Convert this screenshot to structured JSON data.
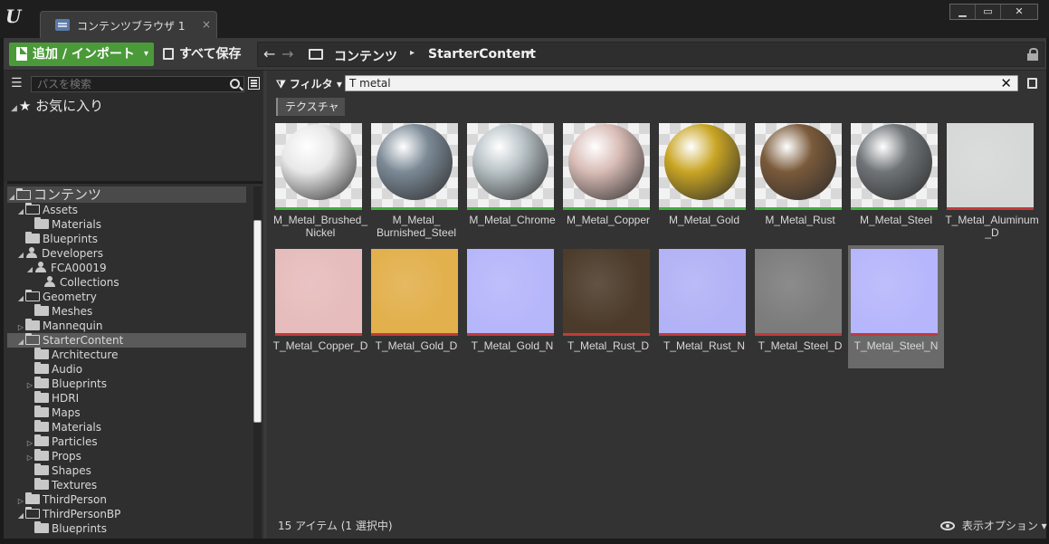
{
  "window": {
    "tab_label": "コンテンツブラウザ 1",
    "tab_close": "×",
    "minimize": "▁",
    "maximize": "▭",
    "close": "✕"
  },
  "toolbar": {
    "add_import_label": "追加 / インポート",
    "add_import_caret": "▾",
    "save_all_label": "すべて保存",
    "back_arrow": "←",
    "forward_arrow": "→",
    "breadcrumbs": [
      "コンテンツ",
      "StarterContent"
    ],
    "crumb_separator": "▸"
  },
  "left_panel": {
    "path_search_placeholder": "パスを検索",
    "favorites_label": "お気に入り",
    "tree": [
      {
        "label": "コンテンツ",
        "arrow": "◢",
        "icon": "folder-open"
      },
      {
        "label": "Assets",
        "arrow": "◢",
        "icon": "folder-open"
      },
      {
        "label": "Materials",
        "arrow": "",
        "icon": "folder"
      },
      {
        "label": "Blueprints",
        "arrow": "",
        "icon": "folder"
      },
      {
        "label": "Developers",
        "arrow": "◢",
        "icon": "person"
      },
      {
        "label": "FCA00019",
        "arrow": "◢",
        "icon": "person"
      },
      {
        "label": "Collections",
        "arrow": "",
        "icon": "person"
      },
      {
        "label": "Geometry",
        "arrow": "◢",
        "icon": "folder-open"
      },
      {
        "label": "Meshes",
        "arrow": "",
        "icon": "folder"
      },
      {
        "label": "Mannequin",
        "arrow": "▷",
        "icon": "folder"
      },
      {
        "label": "StarterContent",
        "arrow": "◢",
        "icon": "folder-open",
        "selected": true
      },
      {
        "label": "Architecture",
        "arrow": "",
        "icon": "folder"
      },
      {
        "label": "Audio",
        "arrow": "",
        "icon": "folder"
      },
      {
        "label": "Blueprints",
        "arrow": "▷",
        "icon": "folder"
      },
      {
        "label": "HDRI",
        "arrow": "",
        "icon": "folder"
      },
      {
        "label": "Maps",
        "arrow": "",
        "icon": "folder"
      },
      {
        "label": "Materials",
        "arrow": "",
        "icon": "folder"
      },
      {
        "label": "Particles",
        "arrow": "▷",
        "icon": "folder"
      },
      {
        "label": "Props",
        "arrow": "▷",
        "icon": "folder"
      },
      {
        "label": "Shapes",
        "arrow": "",
        "icon": "folder"
      },
      {
        "label": "Textures",
        "arrow": "",
        "icon": "folder"
      },
      {
        "label": "ThirdPerson",
        "arrow": "▷",
        "icon": "folder"
      },
      {
        "label": "ThirdPersonBP",
        "arrow": "◢",
        "icon": "folder-open"
      },
      {
        "label": "Blueprints",
        "arrow": "",
        "icon": "folder"
      }
    ]
  },
  "content": {
    "filter_label": "フィルタ",
    "search_value": "T metal",
    "filter_chip": "テクスチャ",
    "assets": [
      {
        "name": "M_Metal_Brushed_\nNickel",
        "kind": "material",
        "color": "#e8e8e8"
      },
      {
        "name": "M_Metal_\nBurnished_Steel",
        "kind": "material",
        "color": "#7c8a96"
      },
      {
        "name": "M_Metal_Chrome",
        "kind": "material",
        "color": "#b8c2c6"
      },
      {
        "name": "M_Metal_Copper",
        "kind": "material",
        "color": "#d9bcb6"
      },
      {
        "name": "M_Metal_Gold",
        "kind": "material",
        "color": "#c9a524"
      },
      {
        "name": "M_Metal_Rust",
        "kind": "material",
        "color": "#7a5a3a"
      },
      {
        "name": "M_Metal_Steel",
        "kind": "material",
        "color": "#6f7478"
      },
      {
        "name": "T_Metal_Aluminum\n_D",
        "kind": "texture",
        "color": "#d6d8d8"
      },
      {
        "name": "T_Metal_Copper_D",
        "kind": "texture",
        "color": "#e6bcbc"
      },
      {
        "name": "T_Metal_Gold_D",
        "kind": "texture",
        "color": "#e2b04c"
      },
      {
        "name": "T_Metal_Gold_N",
        "kind": "texture",
        "color": "#b6b6fb"
      },
      {
        "name": "T_Metal_Rust_D",
        "kind": "texture",
        "color": "#4c3b2a"
      },
      {
        "name": "T_Metal_Rust_N",
        "kind": "texture",
        "color": "#b2b2f6"
      },
      {
        "name": "T_Metal_Steel_D",
        "kind": "texture",
        "color": "#7c7c7c"
      },
      {
        "name": "T_Metal_Steel_N",
        "kind": "texture",
        "color": "#b6b6fc",
        "selected": true
      }
    ],
    "status_text": "15 アイテム (1 選択中)",
    "view_options_label": "表示オプション"
  },
  "colors": {
    "accent_green": "#4b9a3a",
    "material_bar": "#3fae3f",
    "texture_bar": "#c23a3a",
    "panel_bg": "#333333"
  }
}
